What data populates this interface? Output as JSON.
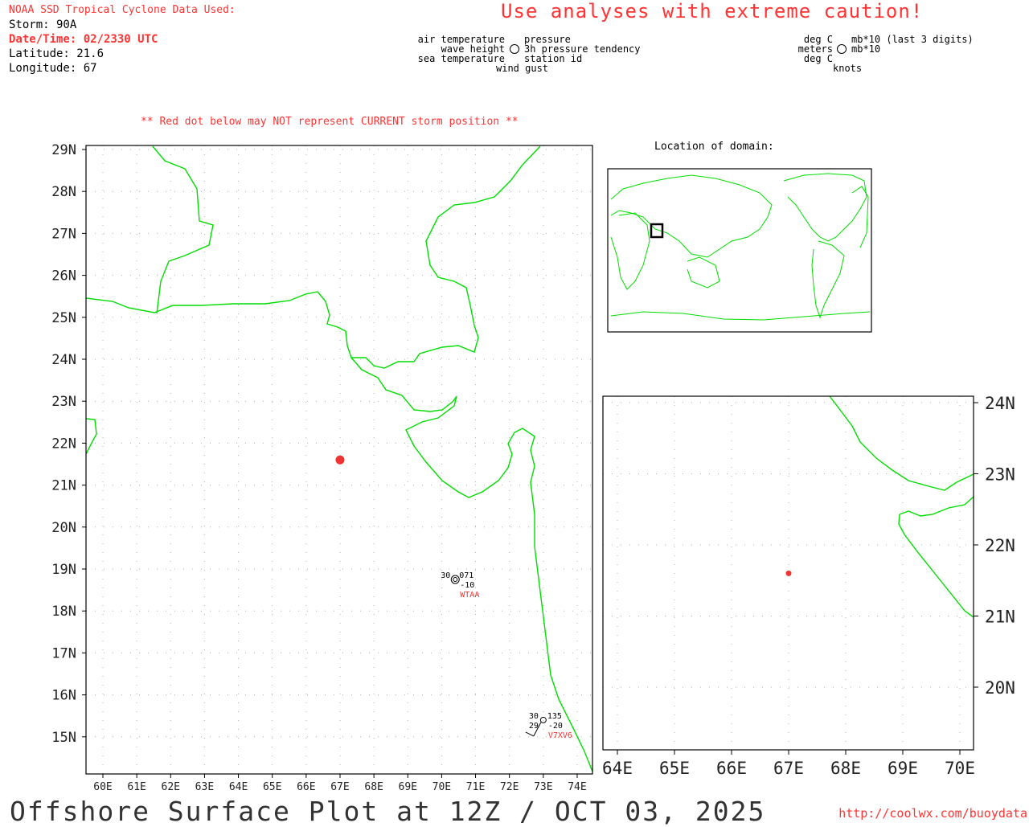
{
  "header": {
    "source": "NOAA SSD Tropical Cyclone Data Used:",
    "storm": "Storm: 90A",
    "datetime": "Date/Time: 02/2330 UTC",
    "latitude": "Latitude: 21.6",
    "longitude": "Longitude: 67",
    "caution": "Use analyses with extreme caution!",
    "red_dot_note": "** Red dot below may NOT represent CURRENT storm position **"
  },
  "station_legend": {
    "air_temperature": "air temperature",
    "wave_height": "wave height",
    "sea_temperature": "sea temperature",
    "wind_gust": "wind gust",
    "pressure": "pressure",
    "pressure_tendency": "3h pressure tendency",
    "station_id": "station id"
  },
  "units_legend": {
    "air_temp_unit": "deg C",
    "wave_unit": "meters",
    "sea_temp_unit": "deg C",
    "pressure_unit": "mb*10 (last 3 digits)",
    "tendency_unit": "mb*10",
    "gust_unit": "knots"
  },
  "main_map": {
    "lat_labels": [
      "29N",
      "28N",
      "27N",
      "26N",
      "25N",
      "24N",
      "23N",
      "22N",
      "21N",
      "20N",
      "19N",
      "18N",
      "17N",
      "16N",
      "15N"
    ],
    "lon_labels": [
      "60E",
      "61E",
      "62E",
      "63E",
      "64E",
      "65E",
      "66E",
      "67E",
      "68E",
      "69E",
      "70E",
      "71E",
      "72E",
      "73E",
      "74E"
    ],
    "storm_position": {
      "lat": 21.6,
      "lon": 67
    },
    "stations": [
      {
        "id": "WTAA",
        "air_temp": "30",
        "pressure": "071",
        "tendency": "-10",
        "lat": 18.75,
        "lon": 70.4
      },
      {
        "id": "V7XV6",
        "air_temp": "30",
        "sea_temp": "29",
        "pressure": "135",
        "tendency": "-20",
        "lat": 15.4,
        "lon": 73
      }
    ],
    "coast_color": "#00dd00"
  },
  "inset_map": {
    "title": "Location of domain:"
  },
  "zoom_map": {
    "lat_labels": [
      "24N",
      "23N",
      "22N",
      "21N",
      "20N"
    ],
    "lon_labels": [
      "64E",
      "65E",
      "66E",
      "67E",
      "68E",
      "69E",
      "70E"
    ],
    "storm_position": {
      "lat": 21.6,
      "lon": 67
    }
  },
  "footer": {
    "title": "Offshore Surface Plot at 12Z / OCT 03, 2025",
    "url": "http://coolwx.com/buoydata"
  }
}
